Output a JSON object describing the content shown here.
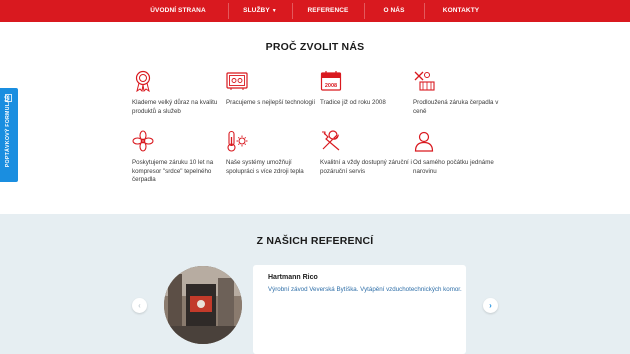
{
  "nav": {
    "items": [
      {
        "label": "ÚVODNÍ STRANA"
      },
      {
        "label": "SLUŽBY",
        "has_dropdown": true
      },
      {
        "label": "REFERENCE"
      },
      {
        "label": "O NÁS"
      },
      {
        "label": "KONTAKTY"
      }
    ]
  },
  "why": {
    "title": "PROČ ZVOLIT NÁS",
    "features": [
      {
        "icon": "award-ribbon-icon",
        "text": "Klademe velký důraz na kvalitu produktů a služeb"
      },
      {
        "icon": "heating-panel-icon",
        "text": "Pracujeme s nejlepší technologií"
      },
      {
        "icon": "calendar-2008-icon",
        "text": "Tradice již od roku 2008",
        "icon_text": "2008"
      },
      {
        "icon": "tools-extended-warranty-icon",
        "text": "Prodloužená záruka čerpadla v ceně"
      },
      {
        "icon": "compressor-fan-icon",
        "text": "Poskytujeme záruku 10 let na kompresor \"srdce\" tepelného čerpadla"
      },
      {
        "icon": "thermometer-sun-icon",
        "text": "Naše systémy umožňují spolupráci s více zdroji tepla"
      },
      {
        "icon": "wrench-screwdriver-icon",
        "text": "Kvalitní a vždy dostupný záruční i pozáruční servis"
      },
      {
        "icon": "person-icon",
        "text": "Od samého počátku jednáme narovinu"
      }
    ]
  },
  "side_tab": {
    "label": "POPTÁVKOVÝ FORMULÁŘ",
    "icon": "document-icon"
  },
  "references": {
    "title": "Z NAŠICH REFERENCÍ",
    "items": [
      {
        "name": "Hartmann Rico",
        "description": "Výrobní závod Veverská Bytíška. Vytápění vzduchotechnických komor."
      }
    ],
    "prev_icon": "chevron-left-icon",
    "next_icon": "chevron-right-icon"
  },
  "colors": {
    "brand_red": "#d9191f",
    "accent_blue": "#1a8ee0",
    "section_bg": "#e6eef2"
  }
}
